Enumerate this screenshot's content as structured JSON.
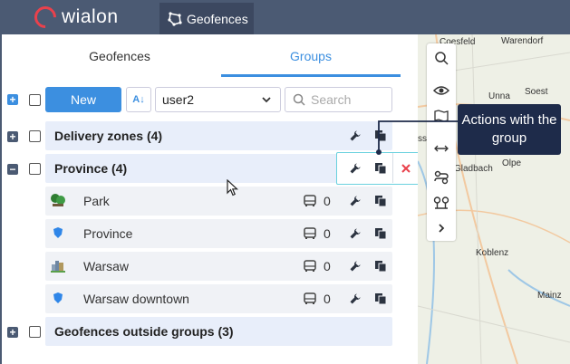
{
  "app": {
    "logo_text": "wialon",
    "active_module": "Geofences"
  },
  "panel": {
    "tabs": [
      {
        "label": "Geofences"
      },
      {
        "label": "Groups",
        "active": true
      }
    ],
    "toolbar": {
      "new_label": "New",
      "sort_label": "A↓",
      "user_value": "user2",
      "search_placeholder": "Search"
    },
    "groups": [
      {
        "label": "Delivery zones (4)"
      },
      {
        "label": "Province (4)"
      },
      {
        "label": "Geofences outside groups (3)"
      }
    ],
    "items": [
      {
        "label": "Park",
        "count": "0"
      },
      {
        "label": "Province",
        "count": "0"
      },
      {
        "label": "Warsaw",
        "count": "0"
      },
      {
        "label": "Warsaw downtown",
        "count": "0"
      }
    ]
  },
  "map": {
    "labels": [
      "Coesfeld",
      "Warendorf",
      "Unna",
      "Soest",
      "sseldorf",
      "Gladbach",
      "Olpe",
      "Koblenz",
      "Mainz"
    ]
  },
  "tooltip": {
    "text": "Actions with the group"
  },
  "colors": {
    "accent": "#3c8fe0",
    "topbar": "#4b5a73",
    "tooltip_bg": "#1e2b4a",
    "delete": "#e9414c"
  }
}
